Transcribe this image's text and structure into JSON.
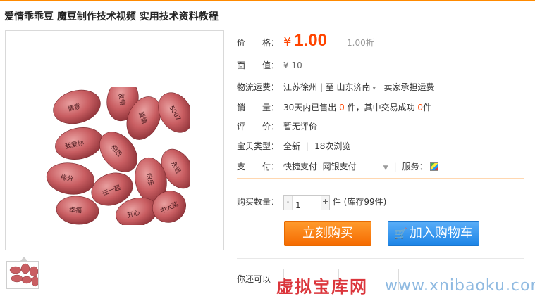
{
  "product": {
    "title": "爱情乖乖豆 魔豆制作技术视频 实用技术资料教程"
  },
  "price": {
    "label": "价　　格：",
    "symbol": "¥",
    "value": "1.00",
    "discount": "1.00折"
  },
  "face_value": {
    "label": "面　　值：",
    "value": "¥ 10"
  },
  "shipping": {
    "label": "物流运费：",
    "from": "江苏徐州",
    "to_word": "至",
    "to": "山东济南",
    "fee": "卖家承担运费"
  },
  "sales": {
    "label": "销　　量：",
    "prefix": "30天内已售出",
    "sold": "0",
    "mid": "件，其中交易成功",
    "success": "0",
    "suffix": "件"
  },
  "rating": {
    "label": "评　　价：",
    "value": "暂无评价"
  },
  "item_type": {
    "label": "宝贝类型：",
    "condition": "全新",
    "views": "18次浏览"
  },
  "payment": {
    "label": "支　　付：",
    "method1": "快捷支付",
    "method2": "网银支付",
    "service_label": "服务："
  },
  "quantity": {
    "label": "购买数量：",
    "minus": "-",
    "value": "1",
    "plus": "+",
    "unit": "件",
    "stock": "(库存99件)"
  },
  "buttons": {
    "buy_now": "立刻购买",
    "add_cart": "加入购物车"
  },
  "also": {
    "label": "你还可以"
  },
  "watermark": {
    "cn": "虚拟宝库网",
    "url": "www.xnibaoku.com"
  },
  "colors": {
    "accent": "#ff4400",
    "buy": "#f56a00",
    "cart": "#1c84e6"
  },
  "bean_labels": [
    "情意",
    "友情",
    "爱情",
    "我爱你",
    "相思",
    "5007",
    "缘分",
    "在一起",
    "快乐",
    "永远",
    "幸福",
    "开心",
    "相思豆",
    "中大奖",
    "爱"
  ]
}
